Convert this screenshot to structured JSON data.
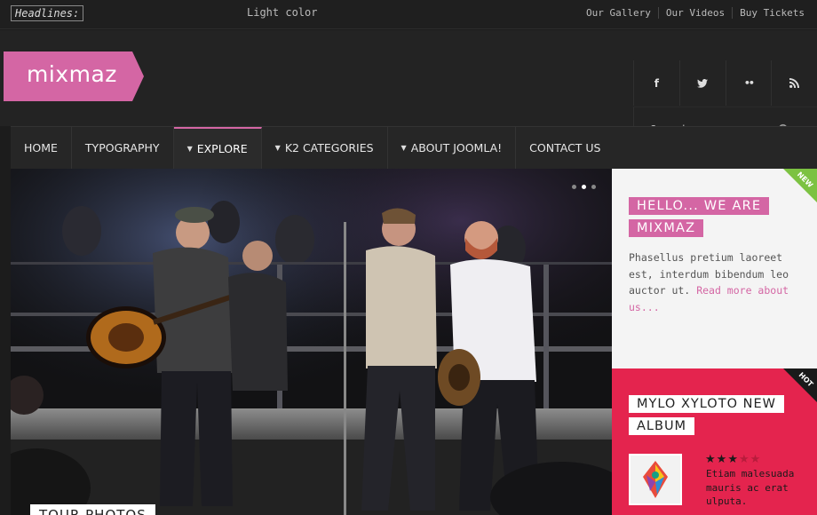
{
  "topbar": {
    "headlines_label": "Headlines:",
    "ticker_text": "Light color",
    "links": [
      "Our Gallery",
      "Our Videos",
      "Buy Tickets"
    ]
  },
  "header": {
    "logo_text": "mixmaz",
    "logo_color": "#d466a4",
    "social_icons": [
      "facebook-icon",
      "twitter-icon",
      "flickr-icon",
      "rss-icon"
    ],
    "social_glyphs": [
      "f",
      "t",
      "••",
      ""
    ],
    "search_placeholder": "Search..."
  },
  "nav": {
    "items": [
      {
        "label": "HOME"
      },
      {
        "label": "TYPOGRAPHY"
      },
      {
        "label": "EXPLORE",
        "active": true
      },
      {
        "label": "K2 CATEGORIES"
      },
      {
        "label": "ABOUT JOOMLA!"
      },
      {
        "label": "CONTACT US"
      }
    ]
  },
  "hero": {
    "caption": "TOUR PHOTOS",
    "slides": 3,
    "active_slide": 2
  },
  "box_new": {
    "badge": "NEW",
    "badge_color": "#7cc242",
    "title": "HELLO... WE ARE MIXMAZ",
    "body": "Phasellus pretium laoreet est, interdum bibendum leo auctor ut.",
    "more_link": "Read more about us..."
  },
  "box_hot": {
    "badge": "HOT",
    "bg_color": "#e4244e",
    "title": "MYLO XYLOTO NEW ALBUM",
    "rating": 3,
    "rating_max": 5,
    "desc": "Etiam malesuada mauris ac erat ulputa."
  }
}
